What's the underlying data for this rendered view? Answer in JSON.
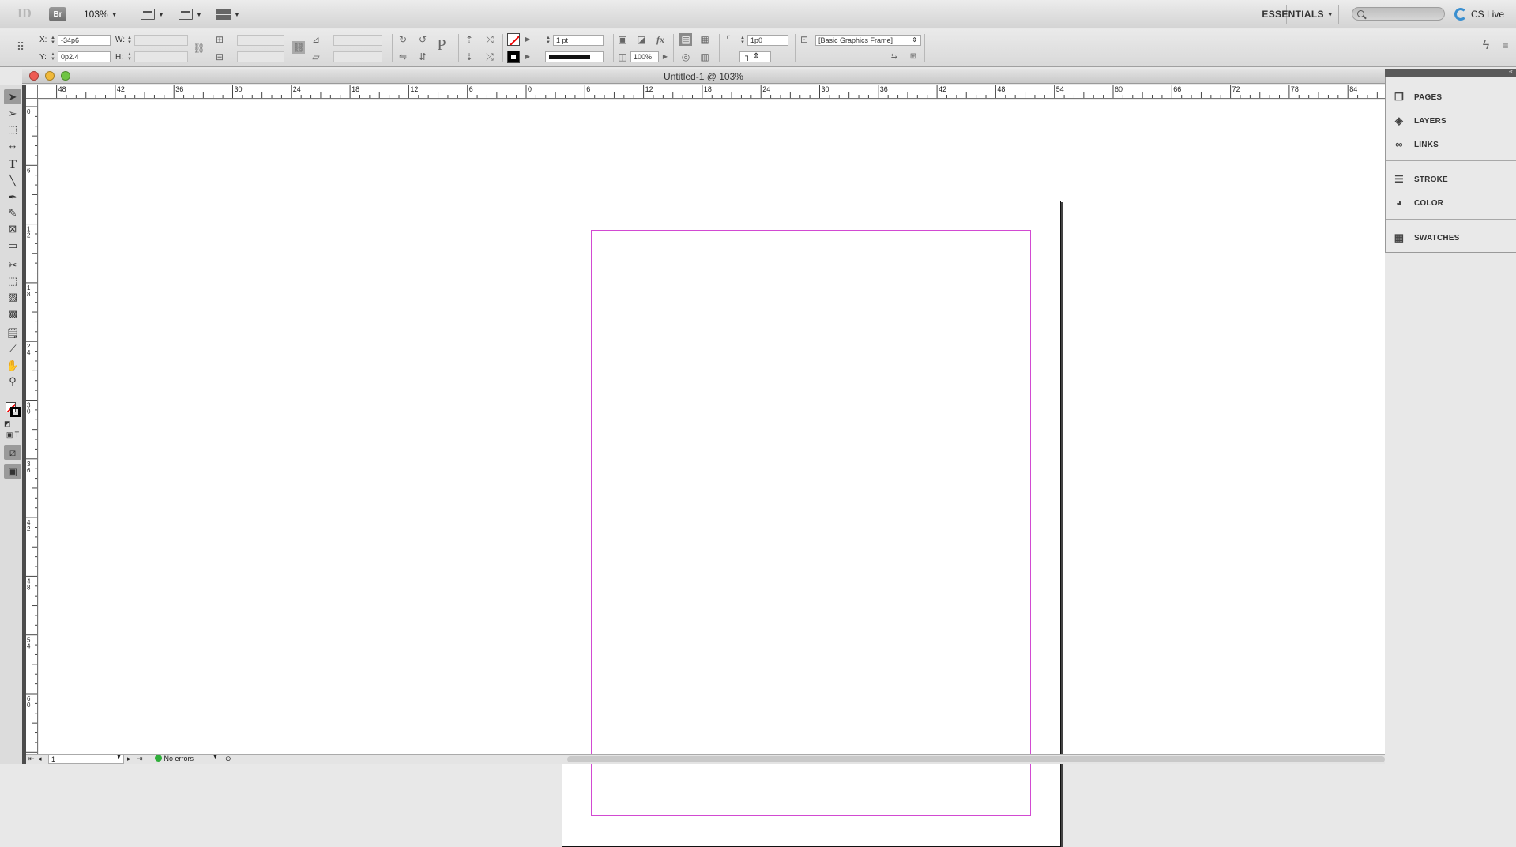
{
  "appbar": {
    "logo": "ID",
    "bridge_label": "Br",
    "zoom": "103%",
    "workspace": "ESSENTIALS",
    "search_placeholder": "",
    "cs_live": "CS Live"
  },
  "control": {
    "x_label": "X:",
    "x_value": "-34p6",
    "y_label": "Y:",
    "y_value": "0p2.4",
    "w_label": "W:",
    "h_label": "H:",
    "stroke_weight": "1 pt",
    "opacity": "100%",
    "corner_value": "1p0",
    "object_style": "[Basic Graphics Frame]"
  },
  "document": {
    "title": "Untitled-1 @ 103%",
    "page_number": "1",
    "preflight": "No errors"
  },
  "rulers": {
    "h_ticks": [
      "48",
      "42",
      "36",
      "30",
      "24",
      "18",
      "12",
      "6",
      "0",
      "6",
      "12",
      "18",
      "24",
      "30",
      "36",
      "42",
      "48",
      "54",
      "60",
      "66",
      "72",
      "78",
      "84"
    ],
    "v_ticks": [
      "0",
      "6",
      "1\n2",
      "1\n8",
      "2\n4",
      "3\n0",
      "3\n6",
      "4\n2",
      "4\n8",
      "5\n4",
      "6\n0",
      "6"
    ]
  },
  "dock": {
    "items": [
      {
        "label": "PAGES",
        "icon": "pages-icon"
      },
      {
        "label": "LAYERS",
        "icon": "layers-icon"
      },
      {
        "label": "LINKS",
        "icon": "links-icon"
      },
      {
        "label": "STROKE",
        "icon": "stroke-icon"
      },
      {
        "label": "COLOR",
        "icon": "color-icon"
      },
      {
        "label": "SWATCHES",
        "icon": "swatches-icon"
      }
    ]
  },
  "colors": {
    "margin_guide": "#d24ad2",
    "status_ok": "#2fae3a"
  }
}
